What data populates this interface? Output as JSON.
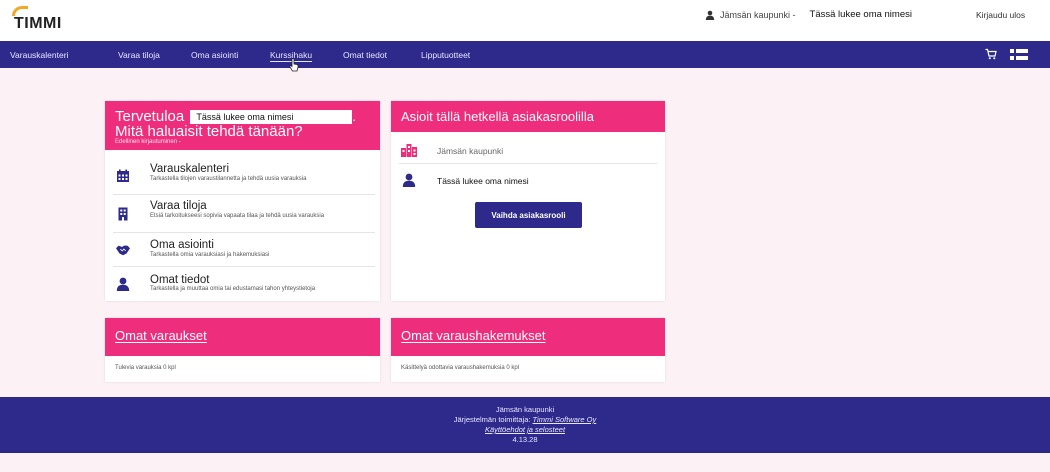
{
  "header": {
    "logo": "TIMMI",
    "organization": "Jämsän kaupunki -",
    "user_name": "Tässä lukee oma nimesi",
    "logout_label": "Kirjaudu ulos"
  },
  "nav": {
    "items": [
      {
        "label": "Varauskalenteri"
      },
      {
        "label": "Varaa tiloja"
      },
      {
        "label": "Oma asiointi"
      },
      {
        "label": "Kurssihaku"
      },
      {
        "label": "Omat tiedot"
      },
      {
        "label": "Lipputuotteet"
      }
    ],
    "active": "Kurssihaku"
  },
  "welcome": {
    "greeting": "Tervetuloa",
    "name": "Tässä lukee oma nimesi",
    "question": "Mitä haluaisit tehdä tänään?",
    "previous_login": "Edellinen kirjautuminen  -",
    "items": [
      {
        "title": "Varauskalenteri",
        "desc": "Tarkastella tilojen varaustilannetta ja tehdä uusia varauksia"
      },
      {
        "title": "Varaa tiloja",
        "desc": "Etsiä tarkoitukseesi sopivia vapaata tilaa ja tehdä uusia varauksia"
      },
      {
        "title": "Oma asiointi",
        "desc": "Tarkastella omia varauksiasi ja hakemuksiasi"
      },
      {
        "title": "Omat tiedot",
        "desc": "Tarkastella ja muuttaa omia tai edustamasi tahon yhteystietoja"
      }
    ]
  },
  "role": {
    "title": "Asioit tällä hetkellä asiakasroolilla",
    "organization": "Jämsän kaupunki",
    "person": "Tässä lukee oma nimesi",
    "switch_label": "Vaihda asiakasrooli"
  },
  "reservations": {
    "title": "Omat varaukset",
    "text": "Tulevia varauksia 0 kpl"
  },
  "applications": {
    "title": "Omat varaushakemukset",
    "text": "Käsittelyä odottavia varaushakemuksia 0 kpl"
  },
  "footer": {
    "organization": "Jämsän kaupunki",
    "provider_prefix": "Järjestelmän toimittaja:",
    "provider": "Timmi Software Oy",
    "terms": "Käyttöehdot ja selosteet",
    "version": "4.13.28"
  },
  "colors": {
    "nav": "#2e2a8c",
    "accent": "#ee2d7c",
    "background": "#fcf2f6"
  }
}
